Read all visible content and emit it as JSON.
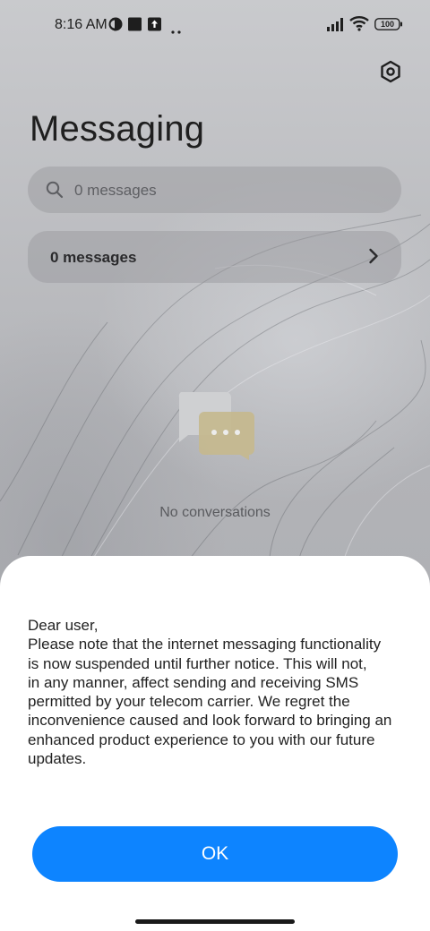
{
  "status_bar": {
    "time": "8:16 AM",
    "battery": "100",
    "left_icons": [
      "vpn-key-icon",
      "square-notification-icon",
      "upload-notification-icon",
      "more-dots-icon"
    ],
    "right_icons": [
      "signal-icon",
      "wifi-icon",
      "battery-icon"
    ]
  },
  "header": {
    "title": "Messaging",
    "settings_icon": "gear-icon"
  },
  "search": {
    "placeholder": "0 messages",
    "icon": "search-icon"
  },
  "messages_row": {
    "label": "0 messages",
    "icon": "chevron-right-icon"
  },
  "empty_state": {
    "icon": "chat-bubbles-icon",
    "text": "No conversations"
  },
  "dialog": {
    "message_lines": [
      "Dear user,",
      "Please note that the internet messaging functionality",
      "is now suspended until further notice. This will not,",
      "in any manner, affect sending and receiving SMS",
      "permitted by your telecom carrier. We regret the",
      "inconvenience caused and look forward to bringing an",
      "enhanced product experience to you with our future",
      "updates."
    ],
    "ok_label": "OK"
  },
  "colors": {
    "accent": "#0d84ff",
    "dialog_background": "#ffffff",
    "text_primary": "#222222"
  }
}
